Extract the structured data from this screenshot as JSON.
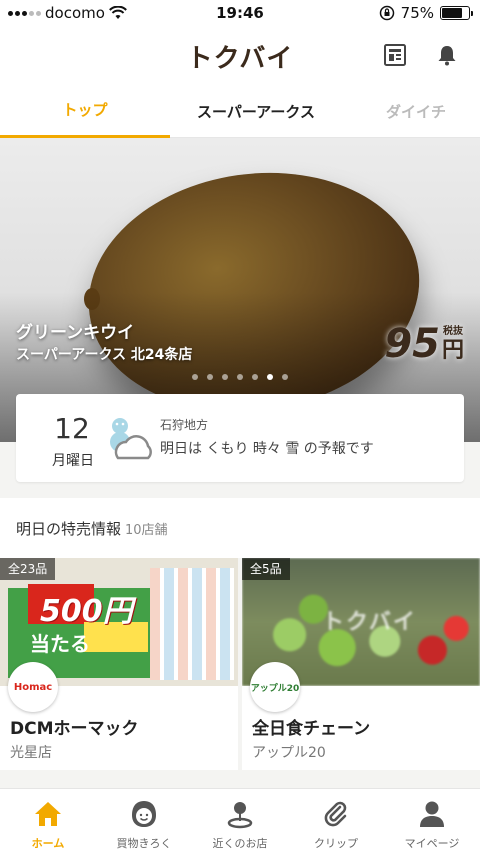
{
  "status_bar": {
    "carrier": "docomo",
    "time": "19:46",
    "battery": "75%",
    "battery_level": 0.75
  },
  "header": {
    "logo": "トクバイ",
    "icons": [
      "flyer-list-icon",
      "bell-icon"
    ]
  },
  "tabs": [
    {
      "label": "トップ",
      "state": "active"
    },
    {
      "label": "スーパーアークス",
      "state": "normal"
    },
    {
      "label": "ダイイチ",
      "state": "faded"
    }
  ],
  "hero": {
    "product": "グリーンキウイ",
    "store": "スーパーアークス 北24条店",
    "price": "95",
    "tax_label": "税抜",
    "yen": "円",
    "slides": 7,
    "active_slide": 6
  },
  "weather": {
    "day": "12",
    "weekday": "月曜日",
    "region": "石狩地方",
    "forecast": "明日は くもり 時々 雪 の予報です",
    "icon": "cloud-snow-icon"
  },
  "section": {
    "title": "明日の特売情報",
    "count": "10店舗"
  },
  "cards": [
    {
      "badge": "全23品",
      "name": "DCMホーマック",
      "branch": "光星店",
      "logo_text": "Homac",
      "flyer_text": "500円",
      "flyer_sub": "当たる"
    },
    {
      "badge": "全5品",
      "name": "全日食チェーン",
      "branch": "アップル20",
      "logo_text": "アップル20",
      "watermark": "トクバイ"
    }
  ],
  "bottom_nav": [
    {
      "label": "ホーム",
      "icon": "home-icon",
      "active": true
    },
    {
      "label": "買物きろく",
      "icon": "face-icon",
      "active": false
    },
    {
      "label": "近くのお店",
      "icon": "location-pin-icon",
      "active": false
    },
    {
      "label": "クリップ",
      "icon": "paperclip-icon",
      "active": false
    },
    {
      "label": "マイページ",
      "icon": "person-icon",
      "active": false
    }
  ],
  "colors": {
    "accent": "#f2a900",
    "brand": "#3b2a1c"
  }
}
